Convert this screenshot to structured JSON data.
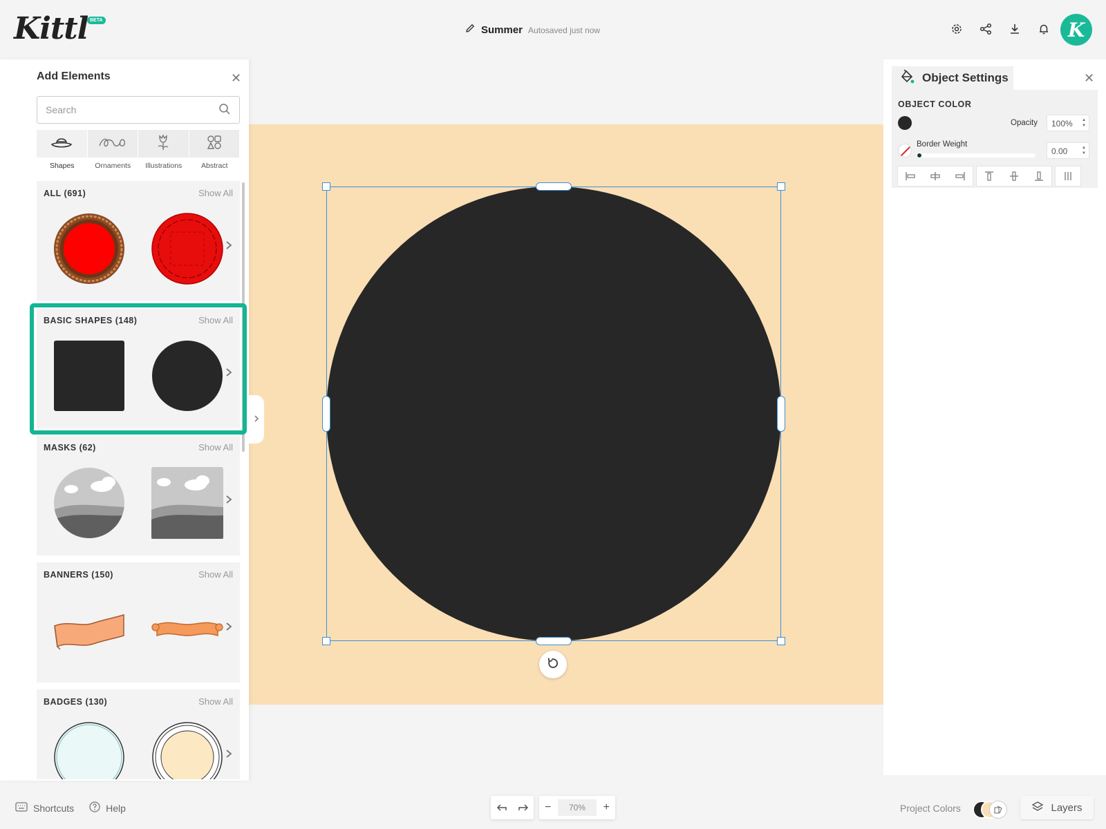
{
  "app": {
    "logo": "Kittl",
    "badge": "BETA"
  },
  "document": {
    "name": "Summer",
    "status": "Autosaved just now"
  },
  "header": {
    "avatar_letter": "K"
  },
  "panel": {
    "title": "Add Elements",
    "search_placeholder": "Search",
    "categories": [
      {
        "label": "Shapes",
        "icon": "hat-icon"
      },
      {
        "label": "Ornaments",
        "icon": "swirl-icon"
      },
      {
        "label": "Illustrations",
        "icon": "flower-icon"
      },
      {
        "label": "Abstract",
        "icon": "abstract-icon"
      }
    ],
    "sections": [
      {
        "title": "ALL (691)",
        "show_all": "Show All"
      },
      {
        "title": "BASIC SHAPES (148)",
        "show_all": "Show All"
      },
      {
        "title": "MASKS (62)",
        "show_all": "Show All"
      },
      {
        "title": "BANNERS (150)",
        "show_all": "Show All"
      },
      {
        "title": "BADGES (130)",
        "show_all": "Show All"
      }
    ]
  },
  "settings": {
    "title": "Object Settings",
    "object_color_label": "OBJECT COLOR",
    "object_color": "#272727",
    "opacity_label": "Opacity",
    "opacity_value": "100%",
    "border_weight_label": "Border Weight",
    "border_weight_value": "0.00"
  },
  "canvas": {
    "background": "#fadfb5",
    "shape_color": "#272727",
    "selection_color": "#3c8fd8"
  },
  "bottom": {
    "shortcuts": "Shortcuts",
    "help": "Help",
    "zoom": "70%",
    "project_colors": "Project Colors",
    "layers": "Layers"
  },
  "colors": {
    "accent": "#13b592",
    "brand": "#1aba98"
  }
}
